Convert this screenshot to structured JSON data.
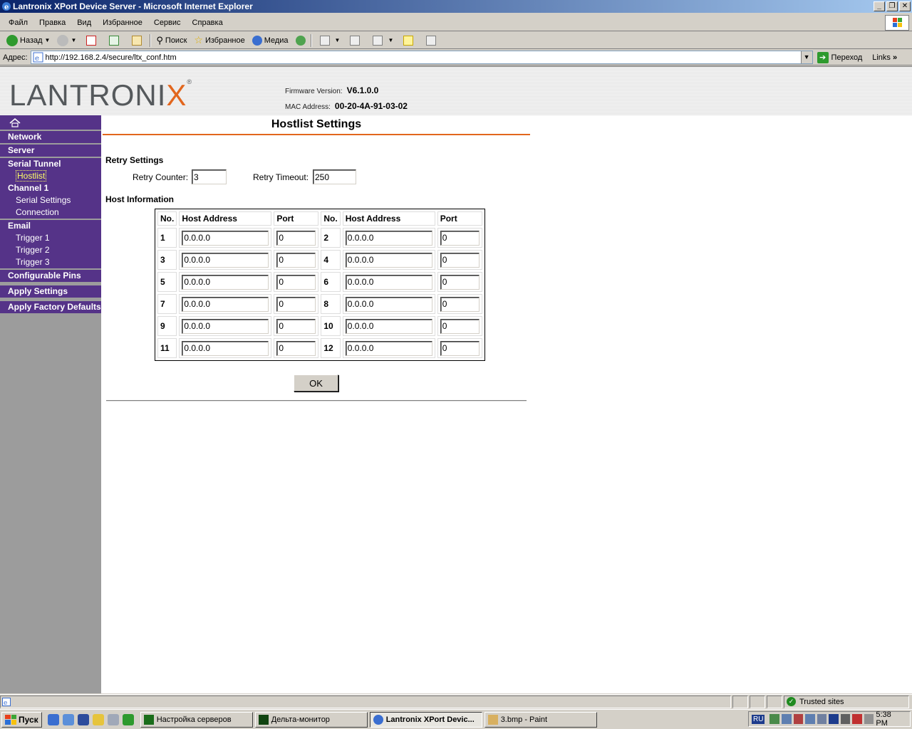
{
  "window": {
    "title": "Lantronix XPort Device Server - Microsoft Internet Explorer",
    "buttons": [
      "_",
      "❐",
      "✕"
    ]
  },
  "menu": [
    "Файл",
    "Правка",
    "Вид",
    "Избранное",
    "Сервис",
    "Справка"
  ],
  "toolbar": {
    "back": "Назад",
    "search": "Поиск",
    "favorites": "Избранное",
    "media": "Медиа"
  },
  "address": {
    "label": "Адрес:",
    "url": "http://192.168.2.4/secure/ltx_conf.htm",
    "go": "Переход",
    "links": "Links",
    "links_chevron": "»"
  },
  "header": {
    "logo_main": "LANTRONI",
    "logo_x": "X",
    "logo_reg": "®",
    "firmware_label": "Firmware Version:",
    "firmware_value": "V6.1.0.0",
    "mac_label": "MAC Address:",
    "mac_value": "00-20-4A-91-03-02"
  },
  "nav": {
    "network": "Network",
    "server": "Server",
    "serial_tunnel": "Serial Tunnel",
    "hostlist": "Hostlist",
    "channel1": "Channel 1",
    "serial_settings": "Serial Settings",
    "connection": "Connection",
    "email": "Email",
    "trigger1": "Trigger 1",
    "trigger2": "Trigger 2",
    "trigger3": "Trigger 3",
    "configurable_pins": "Configurable Pins",
    "apply_settings": "Apply Settings",
    "apply_factory_defaults": "Apply Factory Defaults"
  },
  "content": {
    "title": "Hostlist Settings",
    "retry_section": "Retry Settings",
    "retry_counter_label": "Retry Counter:",
    "retry_counter_value": "3",
    "retry_timeout_label": "Retry Timeout:",
    "retry_timeout_value": "250",
    "host_section": "Host Information",
    "col_no": "No.",
    "col_address": "Host Address",
    "col_port": "Port",
    "hosts": [
      {
        "no": "1",
        "address": "0.0.0.0",
        "port": "0"
      },
      {
        "no": "2",
        "address": "0.0.0.0",
        "port": "0"
      },
      {
        "no": "3",
        "address": "0.0.0.0",
        "port": "0"
      },
      {
        "no": "4",
        "address": "0.0.0.0",
        "port": "0"
      },
      {
        "no": "5",
        "address": "0.0.0.0",
        "port": "0"
      },
      {
        "no": "6",
        "address": "0.0.0.0",
        "port": "0"
      },
      {
        "no": "7",
        "address": "0.0.0.0",
        "port": "0"
      },
      {
        "no": "8",
        "address": "0.0.0.0",
        "port": "0"
      },
      {
        "no": "9",
        "address": "0.0.0.0",
        "port": "0"
      },
      {
        "no": "10",
        "address": "0.0.0.0",
        "port": "0"
      },
      {
        "no": "11",
        "address": "0.0.0.0",
        "port": "0"
      },
      {
        "no": "12",
        "address": "0.0.0.0",
        "port": "0"
      }
    ],
    "ok": "OK"
  },
  "status": {
    "zone": "Trusted sites"
  },
  "taskbar": {
    "start": "Пуск",
    "tasks": [
      {
        "label": "Настройка серверов",
        "active": false
      },
      {
        "label": "Дельта-монитор",
        "active": false
      },
      {
        "label": "Lantronix XPort Devic...",
        "active": true
      },
      {
        "label": "3.bmp - Paint",
        "active": false
      }
    ],
    "lang": "RU",
    "clock": "5:38 PM"
  },
  "colors": {
    "nav_bg": "#553388",
    "accent_orange": "#e2661d",
    "sidebar_gray": "#9c9c9c"
  }
}
